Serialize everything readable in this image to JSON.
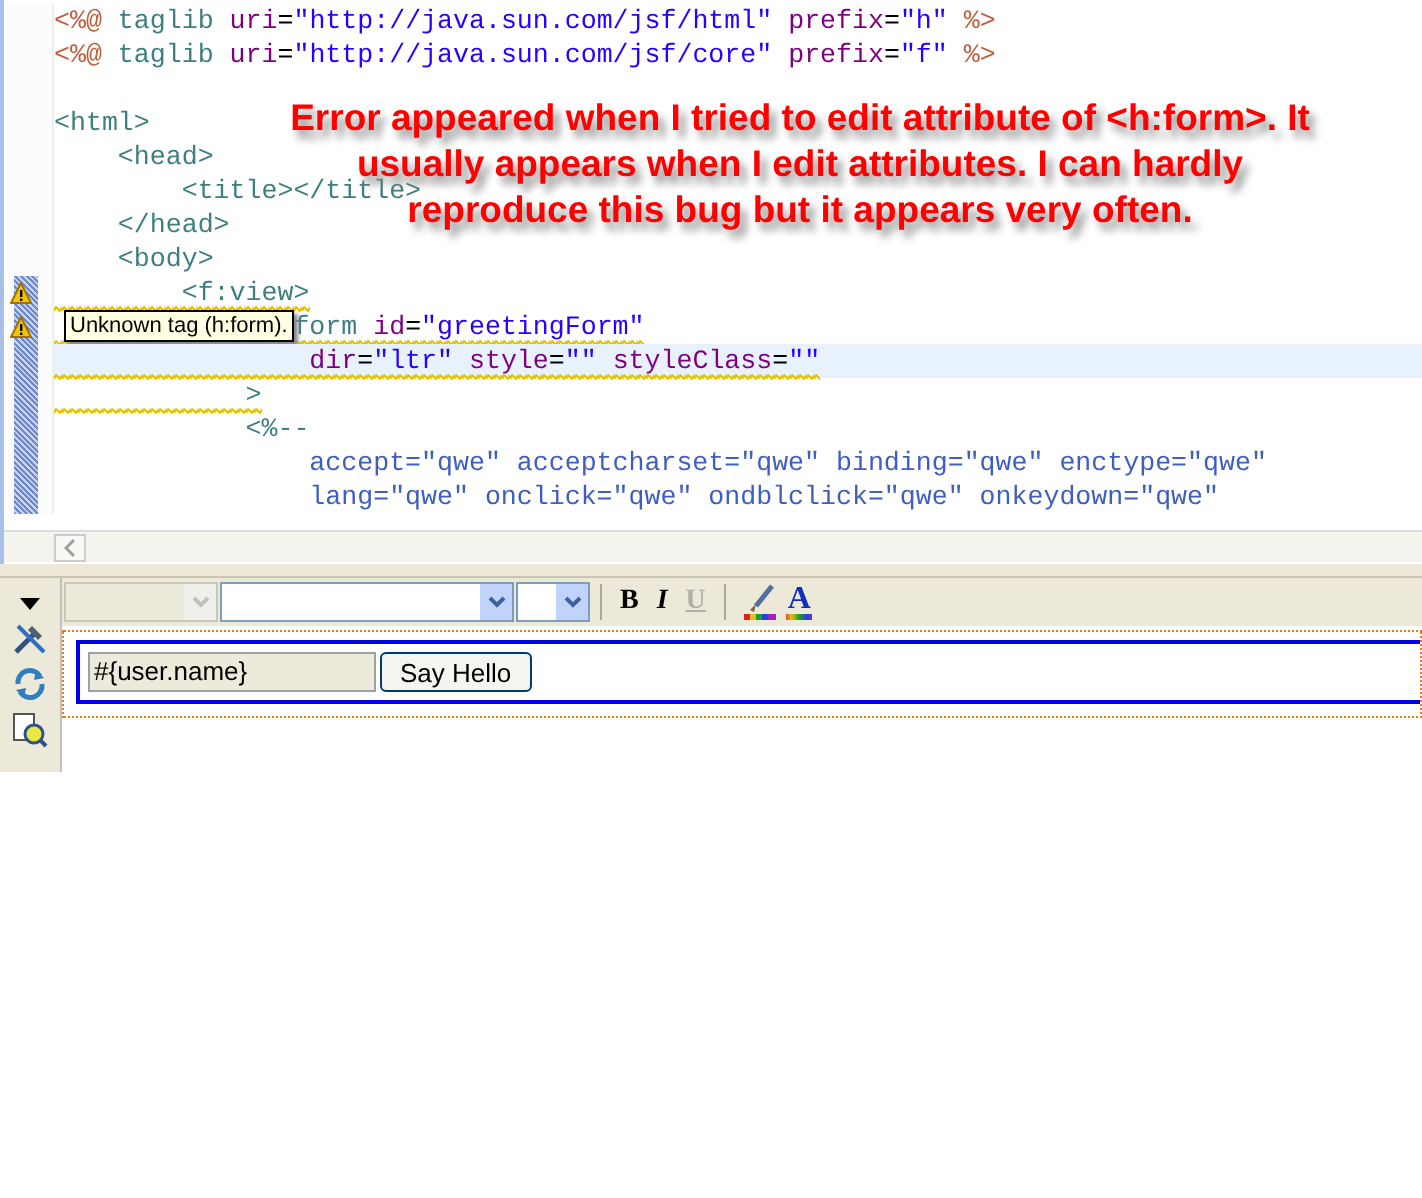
{
  "editor": {
    "lines": [
      {
        "kind": "code",
        "warning": false,
        "current": false,
        "squiggle": false,
        "range": false,
        "segments": [
          {
            "kind": "directive",
            "text": "<%@"
          },
          {
            "kind": "tag",
            "text": " taglib"
          },
          {
            "kind": "attr",
            "text": " uri"
          },
          {
            "kind": "plain",
            "text": "="
          },
          {
            "kind": "value",
            "text": "\"http://java.sun.com/jsf/html\""
          },
          {
            "kind": "attr",
            "text": " prefix"
          },
          {
            "kind": "plain",
            "text": "="
          },
          {
            "kind": "value",
            "text": "\"h\""
          },
          {
            "kind": "directive",
            "text": " %>"
          }
        ]
      },
      {
        "kind": "code",
        "warning": false,
        "current": false,
        "squiggle": false,
        "range": false,
        "segments": [
          {
            "kind": "directive",
            "text": "<%@"
          },
          {
            "kind": "tag",
            "text": " taglib"
          },
          {
            "kind": "attr",
            "text": " uri"
          },
          {
            "kind": "plain",
            "text": "="
          },
          {
            "kind": "value",
            "text": "\"http://java.sun.com/jsf/core\""
          },
          {
            "kind": "attr",
            "text": " prefix"
          },
          {
            "kind": "plain",
            "text": "="
          },
          {
            "kind": "value",
            "text": "\"f\""
          },
          {
            "kind": "directive",
            "text": " %>"
          }
        ]
      },
      {
        "kind": "blank"
      },
      {
        "kind": "code",
        "warning": false,
        "current": false,
        "squiggle": false,
        "range": false,
        "segments": [
          {
            "kind": "tag",
            "text": "<html>"
          }
        ]
      },
      {
        "kind": "code",
        "warning": false,
        "current": false,
        "squiggle": false,
        "range": false,
        "segments": [
          {
            "kind": "tag",
            "text": "    <head>"
          }
        ]
      },
      {
        "kind": "code",
        "warning": false,
        "current": false,
        "squiggle": false,
        "range": false,
        "segments": [
          {
            "kind": "tag",
            "text": "        <title></title>"
          }
        ]
      },
      {
        "kind": "code",
        "warning": false,
        "current": false,
        "squiggle": false,
        "range": false,
        "segments": [
          {
            "kind": "tag",
            "text": "    </head>"
          }
        ]
      },
      {
        "kind": "code",
        "warning": false,
        "current": false,
        "squiggle": false,
        "range": false,
        "segments": [
          {
            "kind": "tag",
            "text": "    <body>"
          }
        ]
      },
      {
        "kind": "code",
        "warning": true,
        "current": false,
        "squiggle": true,
        "range": true,
        "segments": [
          {
            "kind": "tag",
            "text": "        <f:view>"
          }
        ]
      },
      {
        "kind": "code",
        "warning": true,
        "current": false,
        "squiggle": true,
        "range": true,
        "tooltip": "Unknown tag (h:form).",
        "segments": [
          {
            "kind": "tag",
            "text": "               form"
          },
          {
            "kind": "attr",
            "text": " id"
          },
          {
            "kind": "plain",
            "text": "="
          },
          {
            "kind": "value",
            "text": "\"greetingForm\""
          }
        ]
      },
      {
        "kind": "code",
        "warning": false,
        "current": true,
        "squiggle": true,
        "range": true,
        "segments": [
          {
            "kind": "attr",
            "text": "                dir"
          },
          {
            "kind": "plain",
            "text": "="
          },
          {
            "kind": "value",
            "text": "\"ltr\""
          },
          {
            "kind": "attr",
            "text": " style"
          },
          {
            "kind": "plain",
            "text": "="
          },
          {
            "kind": "value",
            "text": "\"\""
          },
          {
            "kind": "attr",
            "text": " styleClass"
          },
          {
            "kind": "plain",
            "text": "="
          },
          {
            "kind": "value",
            "text": "\"\""
          }
        ]
      },
      {
        "kind": "code",
        "warning": false,
        "current": false,
        "squiggle": true,
        "range": true,
        "segments": [
          {
            "kind": "tag",
            "text": "            >"
          }
        ]
      },
      {
        "kind": "code",
        "warning": false,
        "current": false,
        "squiggle": false,
        "range": true,
        "segments": [
          {
            "kind": "tag",
            "text": "            <%--"
          }
        ]
      },
      {
        "kind": "code",
        "warning": false,
        "current": false,
        "squiggle": false,
        "range": true,
        "segments": [
          {
            "kind": "comment",
            "text": "                accept=\"qwe\" acceptcharset=\"qwe\" binding=\"qwe\" enctype=\"qwe\""
          }
        ]
      },
      {
        "kind": "code",
        "warning": false,
        "current": false,
        "squiggle": false,
        "range": true,
        "segments": [
          {
            "kind": "comment",
            "text": "                lang=\"qwe\" onclick=\"qwe\" ondblclick=\"qwe\" onkeydown=\"qwe\""
          }
        ]
      }
    ]
  },
  "annotation": [
    "Error appeared when I tried to edit attribute of <h:form>. It",
    "usually appears when I edit attributes. I can hardly",
    "reproduce this bug but it appears very often."
  ],
  "format_toolbar": {
    "combos": [
      {
        "disabled": true
      },
      {
        "disabled": false
      },
      {
        "disabled": false
      }
    ],
    "buttons": [
      {
        "kind": "bold",
        "label": "B",
        "disabled": false
      },
      {
        "kind": "italic",
        "label": "I",
        "disabled": false
      },
      {
        "kind": "underline",
        "label": "U",
        "disabled": true
      },
      {
        "kind": "highlight",
        "disabled": false
      },
      {
        "kind": "text-color",
        "label": "A",
        "disabled": false
      }
    ]
  },
  "visual_form": {
    "input_value": "#{user.name}",
    "button": "Say Hello"
  }
}
